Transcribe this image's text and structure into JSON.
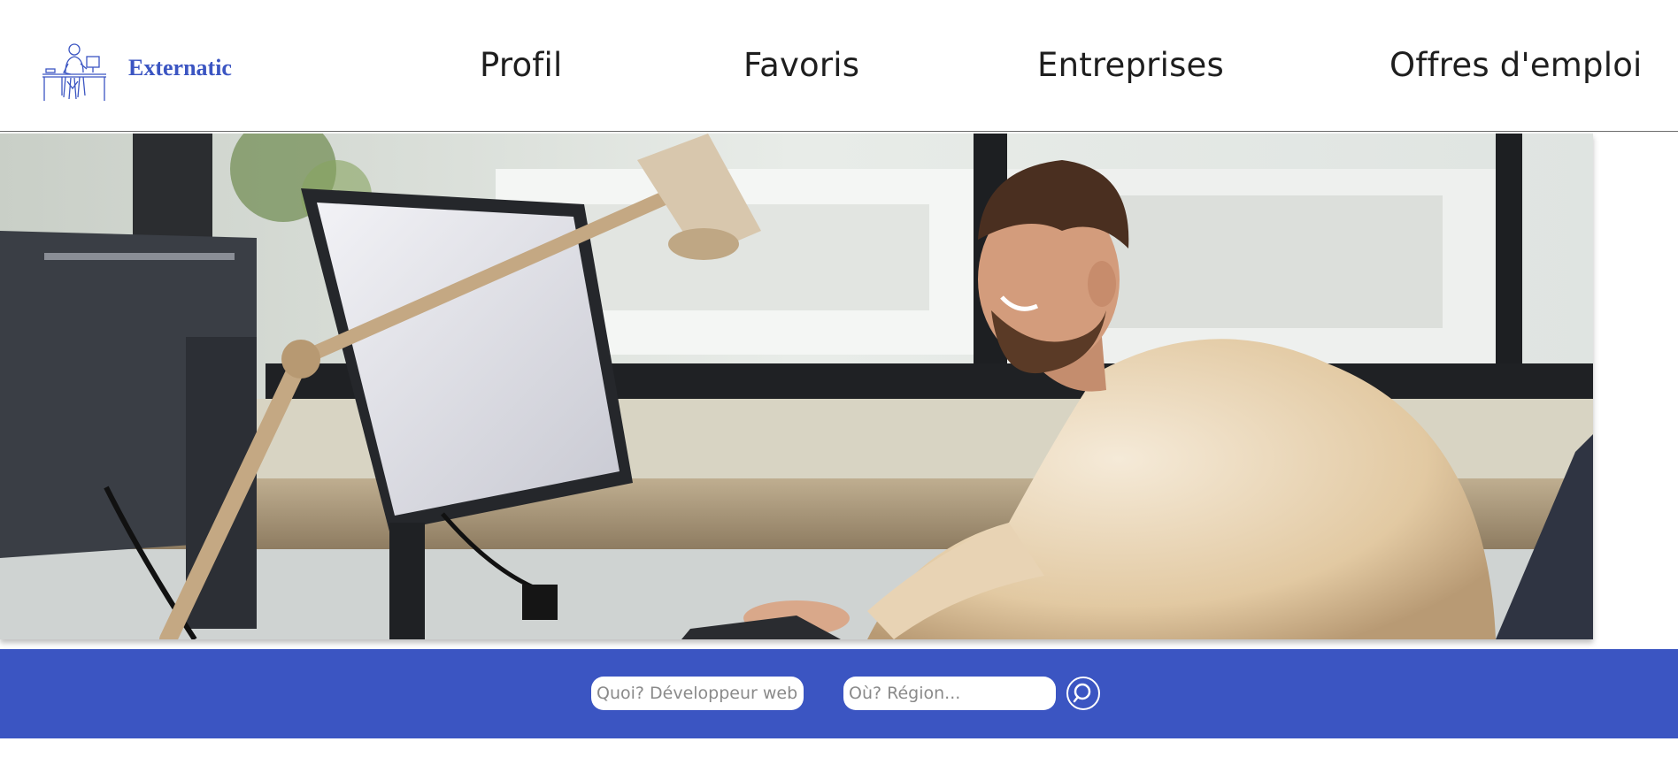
{
  "brand": {
    "name": "Externatic",
    "logo_icon": "office-worker-desk-icon",
    "color": "#3b55c2"
  },
  "nav": {
    "items": [
      {
        "label": "Profil"
      },
      {
        "label": "Favoris"
      },
      {
        "label": "Entreprises"
      },
      {
        "label": "Offres d'emploi"
      }
    ]
  },
  "hero": {
    "image": "smiling-man-working-at-computer-photo"
  },
  "search": {
    "what_placeholder": "Quoi? Développeur web...",
    "where_placeholder": "Où? Région...",
    "button_icon": "search-icon",
    "band_color": "#3b55c2"
  }
}
